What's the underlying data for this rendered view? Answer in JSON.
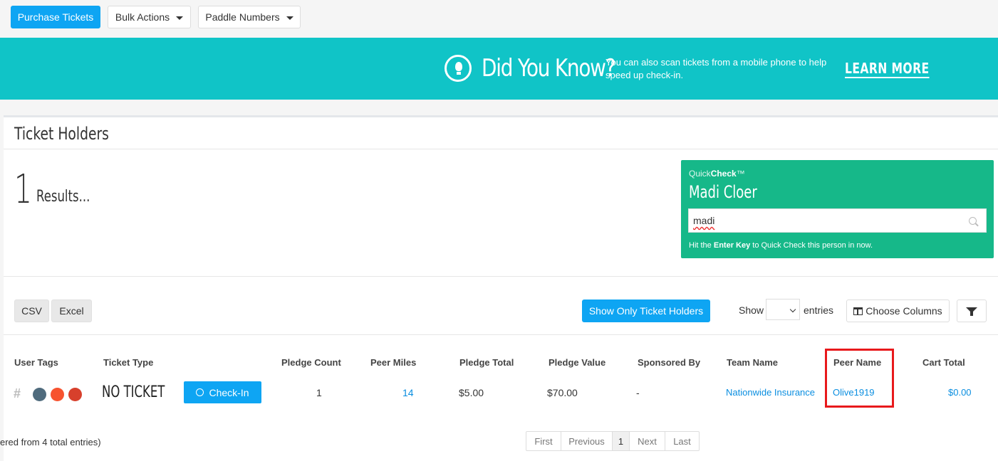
{
  "toolbar": {
    "purchase_label": "Purchase Tickets",
    "bulk_label": "Bulk Actions",
    "paddle_label": "Paddle Numbers"
  },
  "banner": {
    "heading": "Did You Know?",
    "text": "You can also scan tickets from a mobile phone to help speed up check-in.",
    "link_label": "LEARN MORE",
    "color": "#10c4c7"
  },
  "panel": {
    "title": "Ticket Holders",
    "result_count": "1",
    "result_label": "Results..."
  },
  "quickcheck": {
    "brand_light": "Quick",
    "brand_bold": "Check",
    "brand_tm": "™",
    "name": "Madi Cloer",
    "input_value": "madi",
    "hint_prefix": "Hit the ",
    "hint_key": "Enter Key",
    "hint_suffix": " to Quick Check this person in now.",
    "color": "#16b889"
  },
  "controls": {
    "csv_label": "CSV",
    "excel_label": "Excel",
    "show_only_label": "Show Only Ticket Holders",
    "show_label": "Show",
    "entries_label": "entries",
    "choose_columns_label": "Choose Columns"
  },
  "table": {
    "columns": [
      "User Tags",
      "Ticket Type",
      "Pledge Count",
      "Peer Miles",
      "Pledge Total",
      "Pledge Value",
      "Sponsored By",
      "Team Name",
      "Peer Name",
      "Cart Total"
    ],
    "row": {
      "tag_symbol": "#",
      "tag_colors": [
        "#4f6b7d",
        "#f7532f",
        "#d7402c"
      ],
      "ticket_type": "NO TICKET",
      "checkin_label": "Check-In",
      "pledge_count": "1",
      "peer_miles": "14",
      "pledge_total": "$5.00",
      "pledge_value": "$70.00",
      "sponsored_by": "-",
      "team_name": "Nationwide Insurance",
      "peer_name": "Olive1919",
      "cart_total": "$0.00"
    }
  },
  "footer": {
    "info": "ered from 4 total entries)",
    "pages": [
      "First",
      "Previous",
      "1",
      "Next",
      "Last"
    ]
  }
}
